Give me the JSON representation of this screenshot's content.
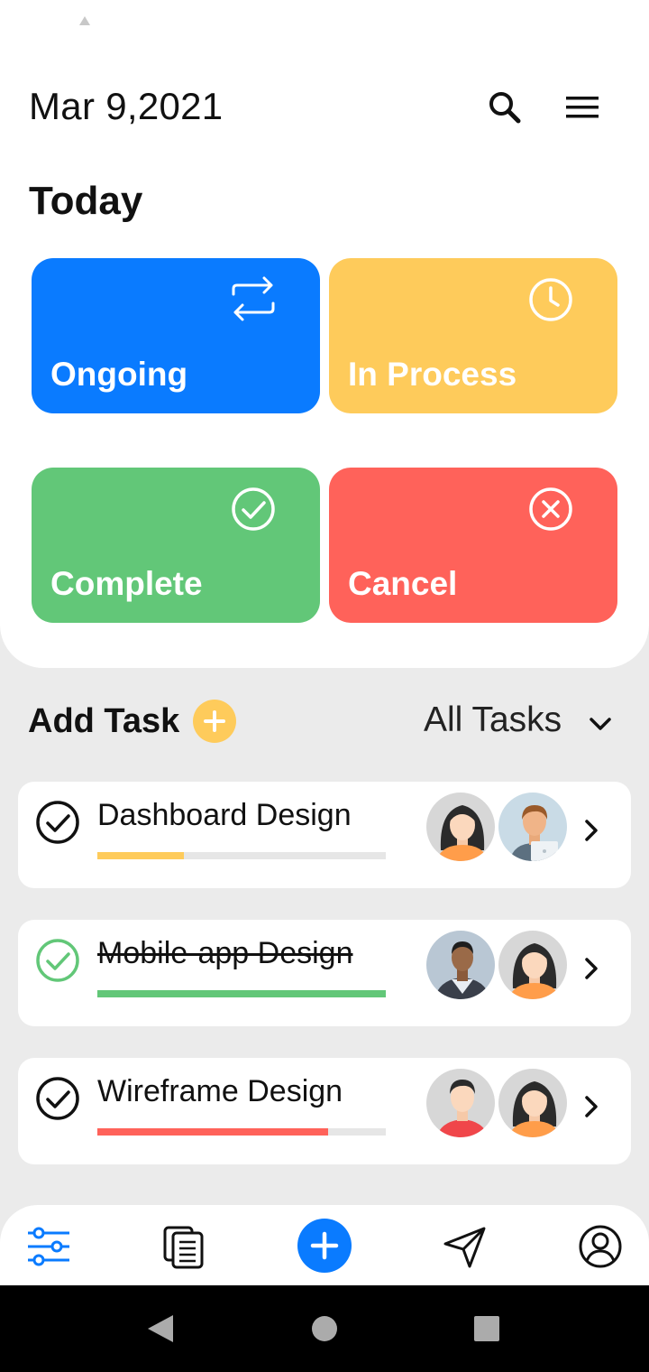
{
  "header": {
    "date": "Mar 9,2021",
    "search_icon": "search-icon",
    "menu_icon": "hamburger-menu-icon"
  },
  "today": {
    "title": "Today",
    "cards": [
      {
        "label": "Ongoing",
        "icon": "repeat-arrows-icon",
        "color": "#0a7bff"
      },
      {
        "label": "In Process",
        "icon": "clock-icon",
        "color": "#fecb5b"
      },
      {
        "label": "Complete",
        "icon": "check-circle-icon",
        "color": "#62c778"
      },
      {
        "label": "Cancel",
        "icon": "x-circle-icon",
        "color": "#ff625a"
      }
    ]
  },
  "tasks_section": {
    "add_label": "Add Task",
    "filter_label": "All Tasks"
  },
  "tasks": [
    {
      "title": "Dashboard Design",
      "progress": 0.3,
      "bar_color": "#fecb5b",
      "completed": false,
      "avatars": [
        "female-avatar",
        "male-laptop-avatar"
      ]
    },
    {
      "title": "Mobile-app Design",
      "progress": 1.0,
      "bar_color": "#62c778",
      "completed": true,
      "avatars": [
        "photo-avatar",
        "female-avatar"
      ]
    },
    {
      "title": "Wireframe Design",
      "progress": 0.8,
      "bar_color": "#ff625a",
      "completed": false,
      "avatars": [
        "male-avatar",
        "female-avatar"
      ]
    }
  ],
  "bottom_nav": {
    "items": [
      "sliders-icon",
      "documents-icon",
      "plus-icon",
      "send-icon",
      "profile-icon"
    ],
    "accent": "#0a7bff"
  }
}
